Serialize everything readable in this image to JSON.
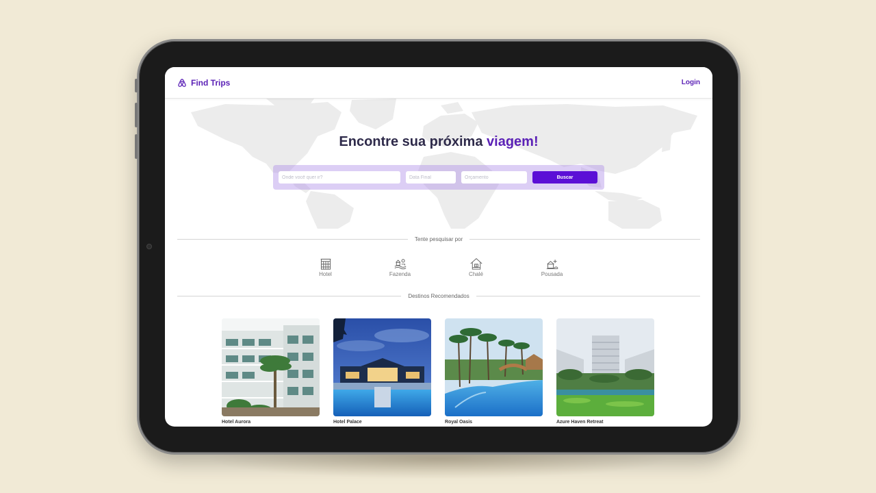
{
  "app": {
    "brand": "Find Trips",
    "login_label": "Login"
  },
  "hero": {
    "title_main": "Encontre sua próxima ",
    "title_accent": "viagem!",
    "search": {
      "destination_placeholder": "Onde você quer ir?",
      "end_date_placeholder": "Data Final",
      "budget_placeholder": "Orçamento",
      "button_label": "Buscar"
    }
  },
  "categories": {
    "heading": "Tente pesquisar por",
    "items": [
      {
        "label": "Hotel",
        "icon": "hotel-icon"
      },
      {
        "label": "Fazenda",
        "icon": "farm-icon"
      },
      {
        "label": "Chalé",
        "icon": "chalet-icon"
      },
      {
        "label": "Pousada",
        "icon": "inn-icon"
      }
    ]
  },
  "destinations": {
    "heading": "Destinos Recomendados",
    "items": [
      {
        "name": "Hotel Aurora"
      },
      {
        "name": "Hotel Palace"
      },
      {
        "name": "Royal Oasis"
      },
      {
        "name": "Azure Haven Retreat"
      }
    ]
  },
  "colors": {
    "accent": "#5b21b6",
    "button": "#5b0fd6",
    "background": "#f1ead6",
    "tablet_frame": "#1b1b1b"
  }
}
